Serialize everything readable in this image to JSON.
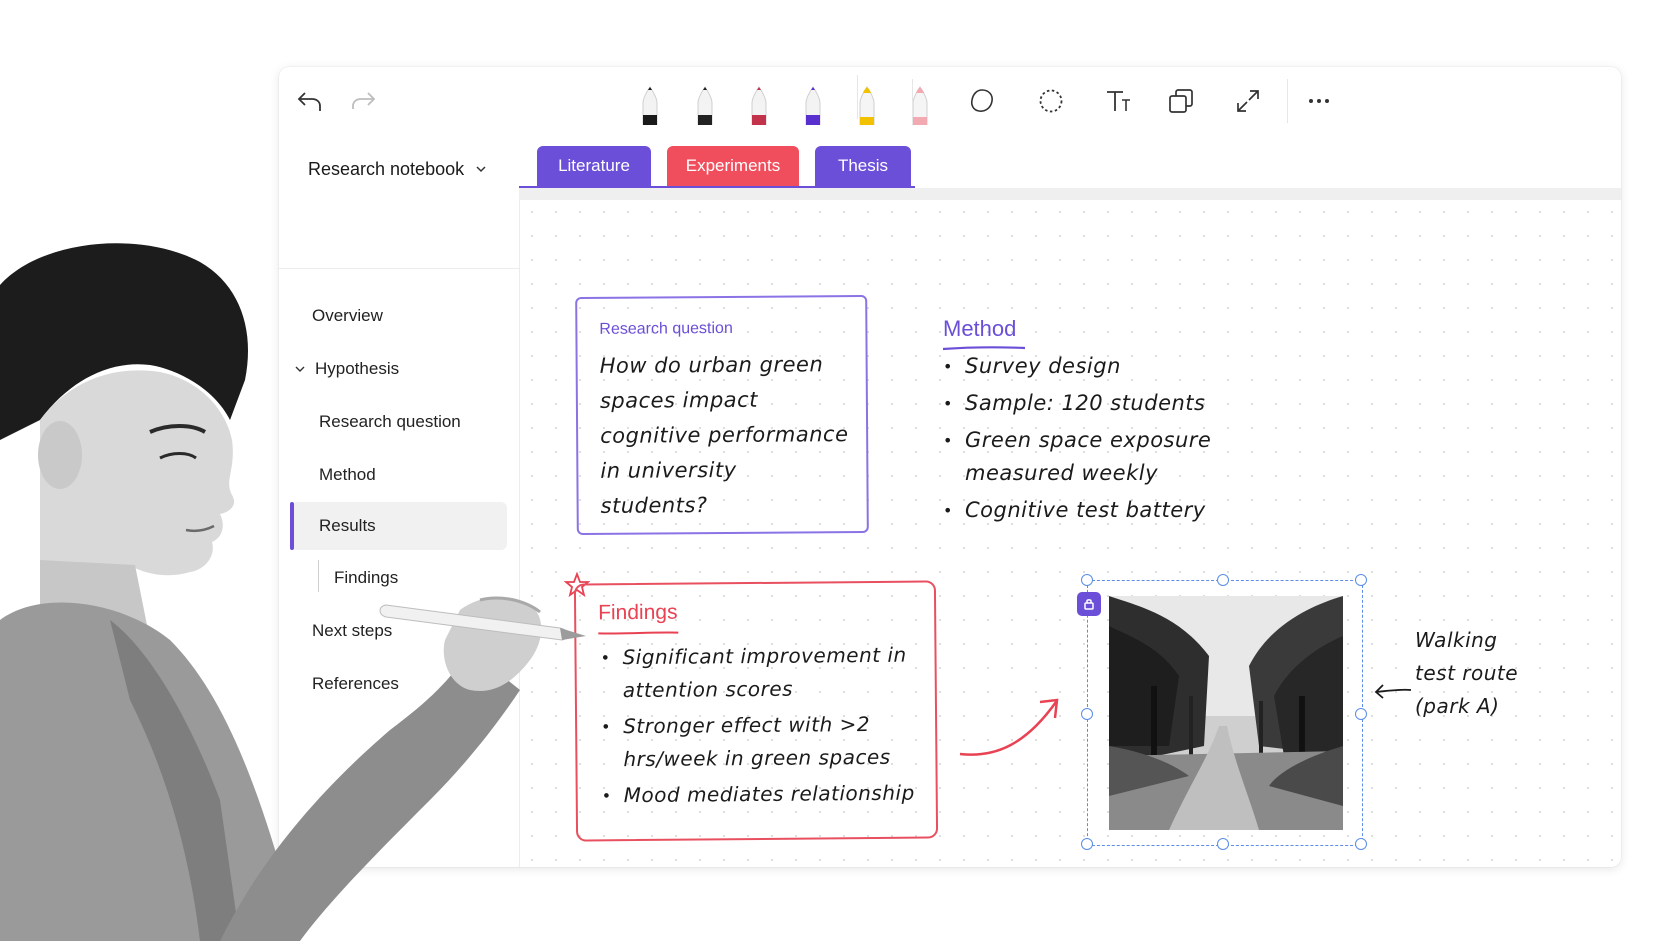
{
  "toolbar": {
    "undo_icon": "undo-arrow-icon",
    "redo_icon": "redo-arrow-icon",
    "pens": [
      {
        "name": "pen-black",
        "color": "#1a1a1a"
      },
      {
        "name": "pen-dark",
        "color": "#222222"
      },
      {
        "name": "pen-red",
        "color": "#c2324a"
      },
      {
        "name": "pen-purple",
        "color": "#5a2fd0"
      },
      {
        "name": "highlighter-yellow",
        "color": "#f2c200"
      },
      {
        "name": "highlighter-pink",
        "color": "#f3a9b2"
      }
    ],
    "tools": [
      "lasso-icon",
      "dotted-lasso-icon",
      "text-icon",
      "shapes-icon",
      "expand-icon",
      "more-icon"
    ]
  },
  "sidebar": {
    "notebook_title": "Research notebook",
    "items": [
      {
        "label": "Overview"
      },
      {
        "label": "Hypothesis"
      },
      {
        "label": "Research question"
      },
      {
        "label": "Method"
      },
      {
        "label": "Results"
      },
      {
        "label": "Findings"
      },
      {
        "label": "Next steps"
      },
      {
        "label": "References"
      }
    ]
  },
  "tabs": [
    {
      "label": "Literature",
      "color": "#6b4fd8"
    },
    {
      "label": "Experiments",
      "color": "#f04e5d"
    },
    {
      "label": "Thesis",
      "color": "#6b4fd8"
    }
  ],
  "canvas": {
    "research_question": {
      "label": "Research question",
      "text": "How do urban green spaces impact cognitive performance in university students?"
    },
    "method": {
      "title": "Method",
      "items": [
        "Survey design",
        "Sample: 120 students",
        "Green space exposure measured weekly",
        "Cognitive test battery"
      ]
    },
    "findings": {
      "title": "Findings",
      "items": [
        "Significant improvement in attention scores",
        "Stronger effect with >2 hrs/week in green spaces",
        "Mood mediates relationship"
      ]
    },
    "image_note": "Walking test route (park A)"
  },
  "colors": {
    "accent_purple": "#6b4fd8",
    "accent_red": "#f04e5d",
    "selection_blue": "#5b8de8"
  }
}
